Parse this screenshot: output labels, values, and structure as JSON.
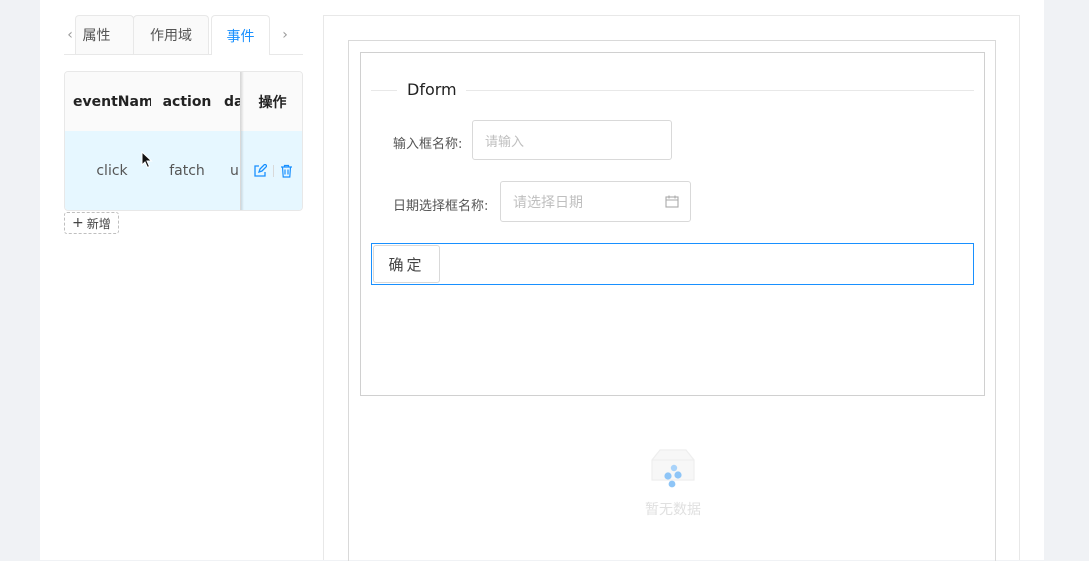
{
  "tabs": {
    "prev_icon": "chevron-left-icon",
    "next_icon": "chevron-right-icon",
    "items": [
      {
        "label": "属性"
      },
      {
        "label": "作用域"
      },
      {
        "label": "事件",
        "active": true
      }
    ]
  },
  "event_table": {
    "columns": [
      "eventName",
      "action",
      "data",
      "操作"
    ],
    "rows": [
      {
        "eventName": "click",
        "action": "fatch",
        "data": "url"
      }
    ],
    "row_actions": [
      "edit-icon",
      "delete-icon"
    ]
  },
  "add_button": {
    "icon": "plus-icon",
    "label": "新增"
  },
  "form": {
    "title": "Dform",
    "fields": [
      {
        "label": "输入框名称:",
        "placeholder": "请输入"
      },
      {
        "label": "日期选择框名称:",
        "placeholder": "请选择日期",
        "icon": "calendar-icon"
      }
    ],
    "submit_label": "确定"
  },
  "empty_state": {
    "icon": "empty-box-icon",
    "text": "暂无数据"
  },
  "colors": {
    "accent": "#1890ff",
    "row_highlight": "#e6f7ff",
    "border": "#e8e8e8"
  }
}
